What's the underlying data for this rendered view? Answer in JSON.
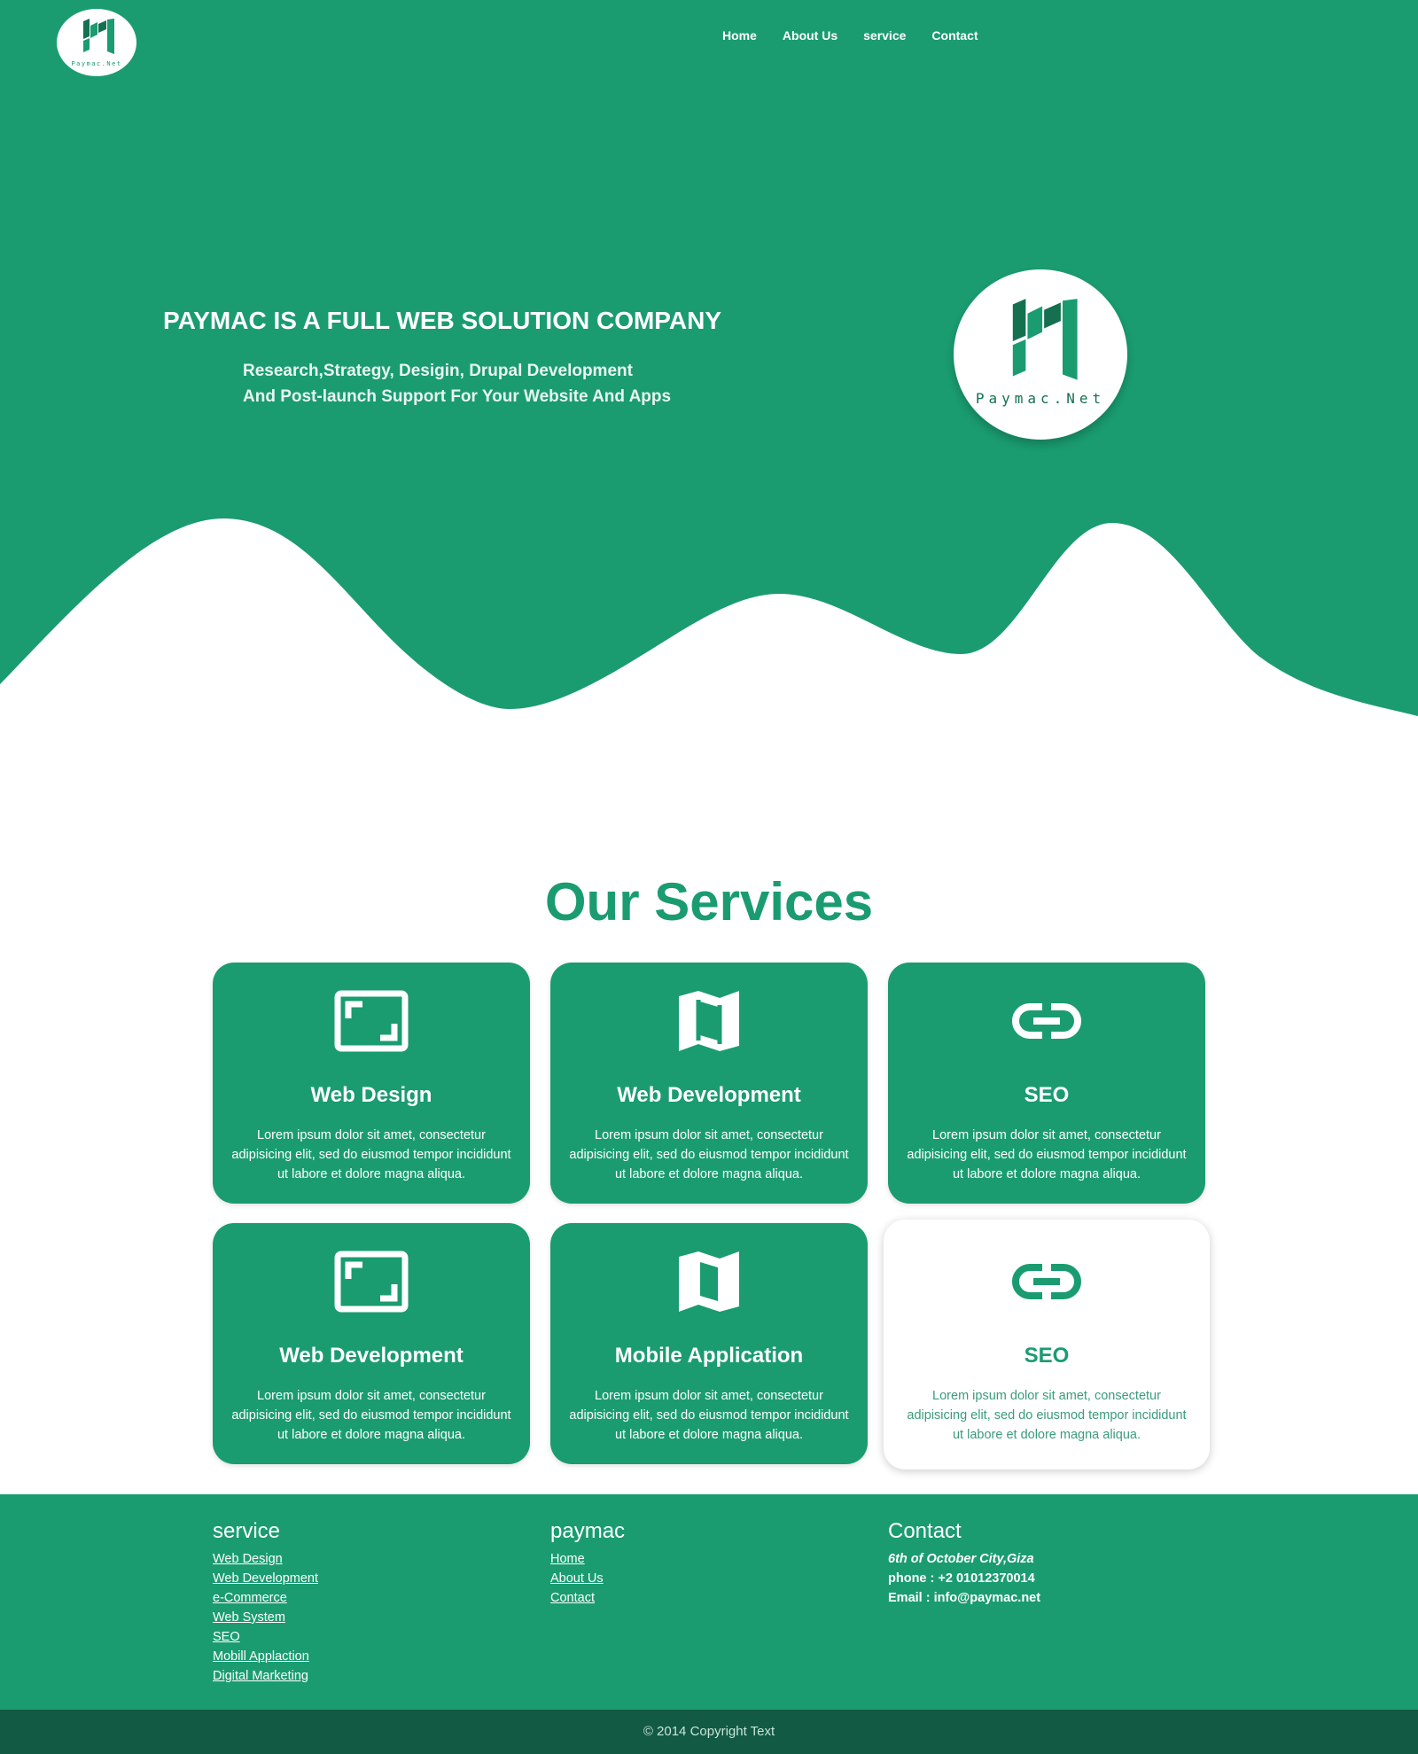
{
  "brand": {
    "logo_text": "Paymac.Net",
    "accent_color": "#1a9c70",
    "dark_color": "#125a43"
  },
  "nav": {
    "items": [
      {
        "label": "Home"
      },
      {
        "label": "About Us"
      },
      {
        "label": "service"
      },
      {
        "label": "Contact"
      }
    ]
  },
  "hero": {
    "title": "PAYMAC IS A FULL WEB SOLUTION COMPANY",
    "subtitle_line1": "Research,Strategy, Desigin, Drupal Development",
    "subtitle_line2": "And Post-launch Support For Your Website And Apps"
  },
  "services": {
    "title": "Our Services",
    "cards": [
      {
        "icon": "frame-icon",
        "title": "Web Design",
        "text": "Lorem ipsum dolor sit amet, consectetur adipisicing elit, sed do eiusmod tempor incididunt ut labore et dolore magna aliqua."
      },
      {
        "icon": "map-icon",
        "title": "Web Development",
        "text": "Lorem ipsum dolor sit amet, consectetur adipisicing elit, sed do eiusmod tempor incididunt ut labore et dolore magna aliqua."
      },
      {
        "icon": "link-icon",
        "title": "SEO",
        "text": "Lorem ipsum dolor sit amet, consectetur adipisicing elit, sed do eiusmod tempor incididunt ut labore et dolore magna aliqua."
      },
      {
        "icon": "frame-icon",
        "title": "Web Development",
        "text": "Lorem ipsum dolor sit amet, consectetur adipisicing elit, sed do eiusmod tempor incididunt ut labore et dolore magna aliqua."
      },
      {
        "icon": "map-icon",
        "title": "Mobile Application",
        "text": "Lorem ipsum dolor sit amet, consectetur adipisicing elit, sed do eiusmod tempor incididunt ut labore et dolore magna aliqua."
      },
      {
        "icon": "link-icon",
        "title": "SEO",
        "text": "Lorem ipsum dolor sit amet, consectetur adipisicing elit, sed do eiusmod tempor incididunt ut labore et dolore magna aliqua."
      }
    ]
  },
  "footer": {
    "service": {
      "heading": "service",
      "items": [
        "Web Design",
        "Web Development",
        "e-Commerce",
        "Web System",
        "SEO",
        "Mobill Applaction",
        "Digital Marketing"
      ]
    },
    "paymac": {
      "heading": "paymac",
      "items": [
        "Home",
        "About Us",
        "Contact"
      ]
    },
    "contact": {
      "heading": "Contact",
      "address": "6th of October City,Giza",
      "phone": "phone : +2 01012370014",
      "email": "Email : info@paymac.net"
    },
    "copyright": "© 2014 Copyright Text"
  }
}
